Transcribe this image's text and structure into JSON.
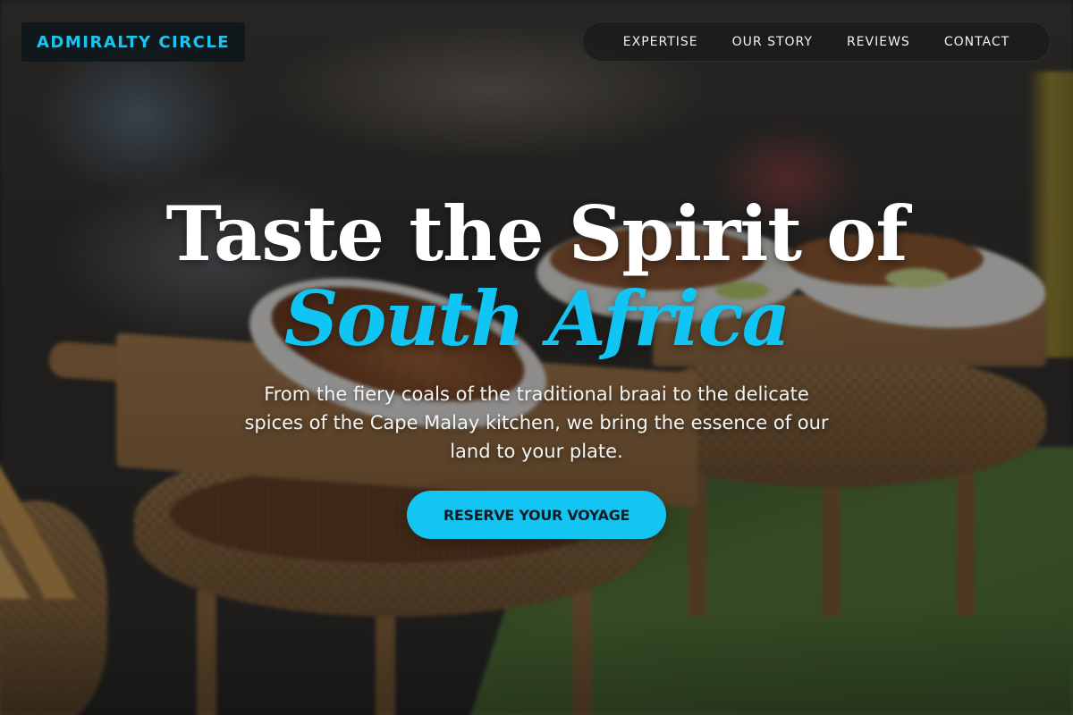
{
  "brand": {
    "name": "ADMIRALTY CIRCLE",
    "accent_color": "#14c5f1"
  },
  "nav": {
    "items": [
      {
        "label": "EXPERTISE"
      },
      {
        "label": "OUR STORY"
      },
      {
        "label": "REVIEWS"
      },
      {
        "label": "CONTACT"
      }
    ]
  },
  "hero": {
    "headline": "Taste the Spirit of",
    "headline_accent": "South Africa",
    "tagline": "From the fiery coals of the traditional braai to the delicate spices of the Cape Malay kitchen, we bring the essence of our land to your plate.",
    "cta_label": "RESERVE YOUR VOYAGE",
    "background_image": "blurred market stall photo with noodle dishes on wooden boards atop wicker baskets, green tablecloth"
  }
}
